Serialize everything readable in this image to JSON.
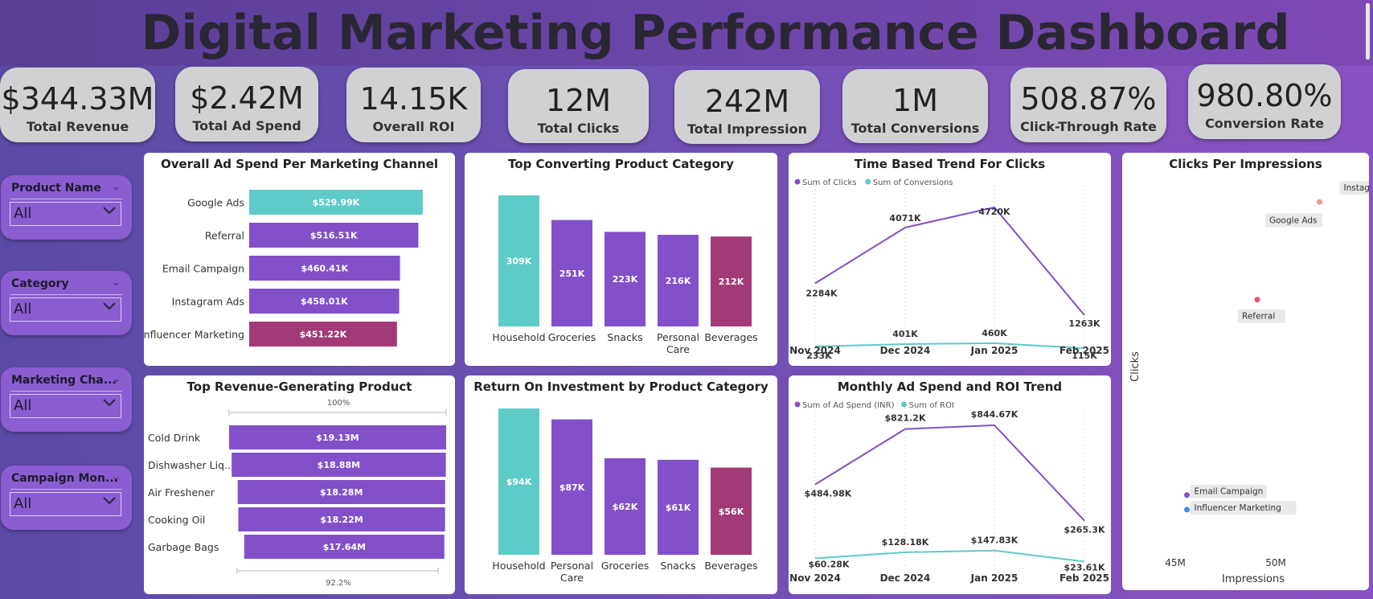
{
  "header": {
    "title": "Digital Marketing Performance Dashboard"
  },
  "kpis": [
    {
      "value": "$344.33M",
      "label": "Total Revenue"
    },
    {
      "value": "$2.42M",
      "label": "Total Ad Spend"
    },
    {
      "value": "14.15K",
      "label": "Overall ROI"
    },
    {
      "value": "12M",
      "label": "Total Clicks"
    },
    {
      "value": "242M",
      "label": "Total Impression"
    },
    {
      "value": "1M",
      "label": "Total Conversions"
    },
    {
      "value": "508.87%",
      "label": "Click-Through Rate"
    },
    {
      "value": "980.80%",
      "label": "Conversion Rate"
    }
  ],
  "slicers": [
    {
      "name": "Product Name",
      "value": "All"
    },
    {
      "name": "Category",
      "value": "All"
    },
    {
      "name": "Marketing Cha...",
      "value": "All"
    },
    {
      "name": "Campaign Mon...",
      "value": "All"
    }
  ],
  "colors": {
    "teal": "#5ecbc8",
    "purple": "#8250c8",
    "magenta": "#a23a78",
    "salmon": "#f2988a",
    "red": "#e8546a",
    "blue": "#3e8fe8"
  },
  "chart_data": [
    {
      "id": "adspend",
      "type": "bar",
      "title": "Overall Ad Spend Per Marketing Channel",
      "orientation": "horizontal",
      "categories": [
        "Google Ads",
        "Referral",
        "Email Campaign",
        "Instagram Ads",
        "Influencer Marketing"
      ],
      "values": [
        529.99,
        516.51,
        460.41,
        458.01,
        451.22
      ],
      "labels": [
        "$529.99K",
        "$516.51K",
        "$460.41K",
        "$458.01K",
        "$451.22K"
      ],
      "bar_colors": [
        "#5ecbc8",
        "#8250c8",
        "#8250c8",
        "#8250c8",
        "#a23a78"
      ]
    },
    {
      "id": "conv",
      "type": "bar",
      "title": "Top Converting Product Category",
      "categories": [
        "Household",
        "Groceries",
        "Snacks",
        "Personal Care",
        "Beverages"
      ],
      "values": [
        309,
        251,
        223,
        216,
        212
      ],
      "labels": [
        "309K",
        "251K",
        "223K",
        "216K",
        "212K"
      ],
      "bar_colors": [
        "#5ecbc8",
        "#8250c8",
        "#8250c8",
        "#8250c8",
        "#a23a78"
      ]
    },
    {
      "id": "clicks_trend",
      "type": "line",
      "title": "Time Based Trend For Clicks",
      "x": [
        "Nov 2024",
        "Dec 2024",
        "Jan 2025",
        "Feb 2025"
      ],
      "series": [
        {
          "name": "Sum of Clicks",
          "values": [
            2284,
            4071,
            4720,
            1263
          ],
          "labels": [
            "2284K",
            "4071K",
            "4720K",
            "1263K"
          ],
          "color": "#8250c8"
        },
        {
          "name": "Sum of Conversions",
          "values": [
            233,
            401,
            460,
            115
          ],
          "labels": [
            "233K",
            "401K",
            "460K",
            "115K"
          ],
          "color": "#5ecbc8"
        }
      ]
    },
    {
      "id": "scatter",
      "type": "scatter",
      "title": "Clicks Per Impressions",
      "xlabel": "Impressions",
      "ylabel": "Clicks",
      "x_ticks": [
        "45M",
        "50M"
      ],
      "points": [
        {
          "name": "Instagram Ads",
          "x": 52.1,
          "y": 2.52,
          "color": "#f2988a"
        },
        {
          "name": "Google Ads",
          "x": 50.6,
          "y": 2.5,
          "color": "#5ecbc8"
        },
        {
          "name": "Referral",
          "x": 49.0,
          "y": 2.42,
          "color": "#e8546a"
        },
        {
          "name": "Email Campaign",
          "x": 45.5,
          "y": 2.22,
          "color": "#8250c8"
        },
        {
          "name": "Influencer Marketing",
          "x": 45.5,
          "y": 2.205,
          "color": "#3e8fe8"
        }
      ]
    },
    {
      "id": "revenue",
      "type": "bar",
      "title": "Top Revenue-Generating Product",
      "orientation": "horizontal",
      "categories": [
        "Cold Drink",
        "Dishwasher Liq...",
        "Air Freshener",
        "Cooking Oil",
        "Garbage Bags"
      ],
      "values": [
        19.13,
        18.88,
        18.28,
        18.22,
        17.64
      ],
      "labels": [
        "$19.13M",
        "$18.88M",
        "$18.28M",
        "$18.22M",
        "$17.64M"
      ],
      "top_axis_label": "100%",
      "bottom_axis_label": "92.2%",
      "bar_colors": [
        "#8250c8",
        "#8250c8",
        "#8250c8",
        "#8250c8",
        "#8250c8"
      ]
    },
    {
      "id": "roi",
      "type": "bar",
      "title": "Return On Investment by Product Category",
      "categories": [
        "Household",
        "Personal Care",
        "Groceries",
        "Snacks",
        "Beverages"
      ],
      "values": [
        94,
        87,
        62,
        61,
        56
      ],
      "labels": [
        "$94K",
        "$87K",
        "$62K",
        "$61K",
        "$56K"
      ],
      "bar_colors": [
        "#5ecbc8",
        "#8250c8",
        "#8250c8",
        "#8250c8",
        "#a23a78"
      ]
    },
    {
      "id": "adspend_trend",
      "type": "line",
      "title": "Monthly Ad Spend and ROI Trend",
      "x": [
        "Nov 2024",
        "Dec 2024",
        "Jan 2025",
        "Feb 2025"
      ],
      "series": [
        {
          "name": "Sum of Ad Spend (INR)",
          "values": [
            484.98,
            821.2,
            844.67,
            265.3
          ],
          "labels": [
            "$484.98K",
            "$821.2K",
            "$844.67K",
            "$265.3K"
          ],
          "color": "#8250c8"
        },
        {
          "name": "Sum of ROI",
          "values": [
            60.28,
            128.18,
            147.83,
            23.61
          ],
          "labels": [
            "$60.28K",
            "$128.18K",
            "$147.83K",
            "$23.61K"
          ],
          "color": "#5ecbc8"
        }
      ]
    }
  ]
}
